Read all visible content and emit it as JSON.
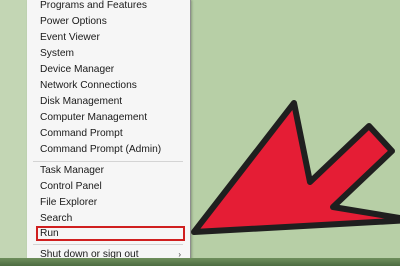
{
  "context_menu": {
    "items": [
      {
        "label": "Programs and Features"
      },
      {
        "label": "Power Options"
      },
      {
        "label": "Event Viewer"
      },
      {
        "label": "System"
      },
      {
        "label": "Device Manager"
      },
      {
        "label": "Network Connections"
      },
      {
        "label": "Disk Management"
      },
      {
        "label": "Computer Management"
      },
      {
        "label": "Command Prompt"
      },
      {
        "label": "Command Prompt (Admin)"
      },
      {
        "label": "Task Manager"
      },
      {
        "label": "Control Panel"
      },
      {
        "label": "File Explorer"
      },
      {
        "label": "Search"
      },
      {
        "label": "Run"
      },
      {
        "label": "Shut down or sign out"
      }
    ],
    "submenu_arrow": "›"
  },
  "colors": {
    "desktop_background": "#b7cfa6",
    "arrow_fill": "#e51d35",
    "arrow_outline": "#1f1f1f",
    "highlight_border": "#d01f1f"
  },
  "icons": {
    "pointer": "red-arrow-icon"
  }
}
